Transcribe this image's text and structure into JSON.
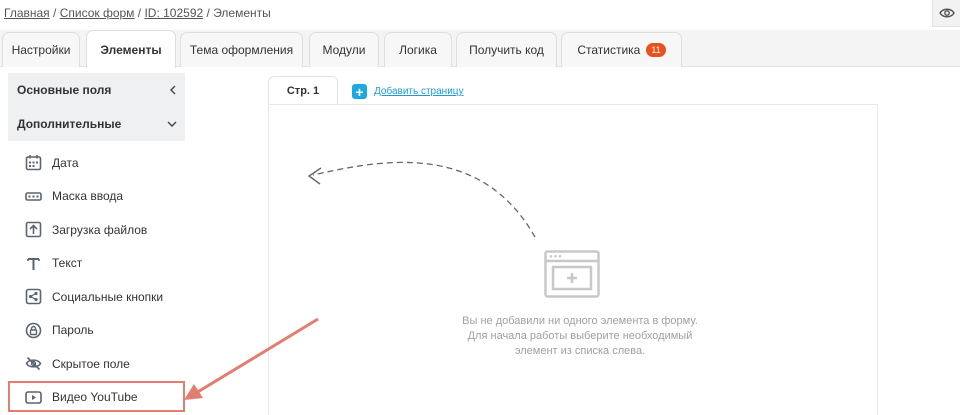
{
  "breadcrumb": {
    "home": "Главная",
    "sep1": " / ",
    "forms": "Список форм",
    "sep2": " / ",
    "id": "ID: 102592",
    "sep3": " / ",
    "current": "Элементы"
  },
  "tabs": [
    {
      "label": "Настройки",
      "active": false
    },
    {
      "label": "Элементы",
      "active": true
    },
    {
      "label": "Тема оформления",
      "active": false
    },
    {
      "label": "Модули",
      "active": false
    },
    {
      "label": "Логика",
      "active": false
    },
    {
      "label": "Получить код",
      "active": false
    },
    {
      "label": "Статистика",
      "active": false,
      "badge": "11"
    }
  ],
  "sidebar": {
    "groups": [
      {
        "label": "Основные поля",
        "state": "collapsed",
        "icon": "chevron-left-icon"
      },
      {
        "label": "Дополнительные",
        "state": "expanded",
        "icon": "chevron-down-icon"
      }
    ],
    "items": [
      {
        "label": "Дата",
        "icon": "calendar-icon"
      },
      {
        "label": "Маска ввода",
        "icon": "input-mask-icon"
      },
      {
        "label": "Загрузка файлов",
        "icon": "file-upload-icon"
      },
      {
        "label": "Текст",
        "icon": "text-icon"
      },
      {
        "label": "Социальные кнопки",
        "icon": "share-icon"
      },
      {
        "label": "Пароль",
        "icon": "lock-icon"
      },
      {
        "label": "Скрытое поле",
        "icon": "eye-off-icon"
      },
      {
        "label": "Видео YouTube",
        "icon": "video-play-icon"
      }
    ]
  },
  "pages": {
    "tabs": [
      {
        "label": "Стр. 1"
      }
    ],
    "add_label": "Добавить страницу"
  },
  "empty_state": {
    "line1": "Вы не добавили ни одного элемента в форму.",
    "line2": "Для начала работы выберите необходимый",
    "line3": "элемент из списка слева."
  },
  "colors": {
    "accent": "#1ea8e0",
    "badge": "#e8521e",
    "highlight": "#e27e71",
    "icon": "#5b6470"
  }
}
